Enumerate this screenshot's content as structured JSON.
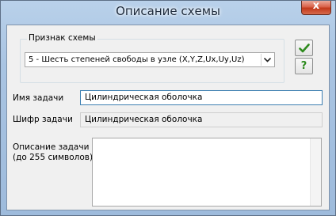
{
  "window": {
    "title": "Описание схемы",
    "close_glyph": "x"
  },
  "scheme_group": {
    "legend": "Признак схемы",
    "selected": "5 - Шесть степеней свободы в узле (X,Y,Z,Ux,Uy,Uz)"
  },
  "buttons": {
    "ok_icon": "checkmark-icon",
    "help_icon": "question-icon",
    "help_glyph": "?"
  },
  "task_name": {
    "label": "Имя задачи",
    "value": "Цилиндрическая оболочка"
  },
  "task_code": {
    "label": "Шифр задачи",
    "value": "Цилиндрическая оболочка"
  },
  "description": {
    "label_line1": "Описание задачи",
    "label_line2": "(до 255 символов)",
    "value": ""
  },
  "colors": {
    "ok_green": "#2e8b1e",
    "help_green": "#2e8b1e",
    "focus_border": "#3c7fb1"
  }
}
